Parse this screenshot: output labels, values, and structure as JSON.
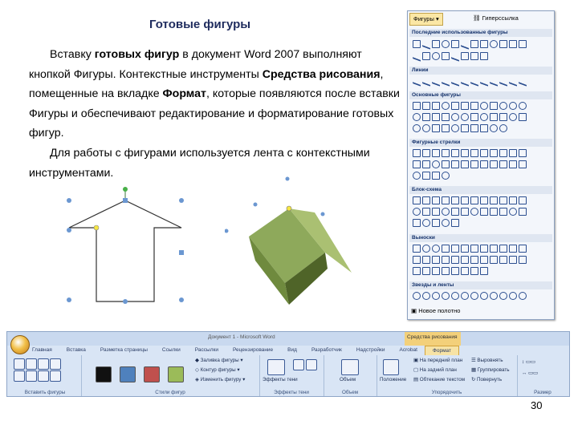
{
  "title": "Готовые фигуры",
  "para1": {
    "p1": "Вставку ",
    "b1": "готовых фигур",
    "p2": " в документ Word 2007 выполняют кнопкой Фигуры. Контекстные инструменты ",
    "b2": "Средства рисования",
    "p3": ", помещенные на вкладке ",
    "b3": "Формат",
    "p4": ", которые появляются после вставки Фигуры и обеспечивают редактирование и форматирование готовых фигур."
  },
  "para2": "Для работы с фигурами используется лента с контекстными инструментами.",
  "page_number": "30",
  "gallery": {
    "button": "Фигуры",
    "button2": "Гиперссылка",
    "sections": [
      "Последние использованные фигуры",
      "Линии",
      "Основные фигуры",
      "Фигурные стрелки",
      "Блок-схема",
      "Выноски",
      "Звезды и ленты"
    ],
    "footer": "Новое полотно"
  },
  "ribbon": {
    "window_title": "Документ 1 - Microsoft Word",
    "context_title": "Средства рисования",
    "tabs": [
      "Главная",
      "Вставка",
      "Разметка страницы",
      "Ссылки",
      "Рассылки",
      "Рецензирование",
      "Вид",
      "Разработчик",
      "Надстройки",
      "Acrobat",
      "Формат"
    ],
    "groups": {
      "insert_shapes": "Вставить фигуры",
      "shape_styles": "Стили фигур",
      "shadow_effects": "Эффекты тени",
      "volume": "Объем",
      "arrange": "Упорядочить",
      "size": "Размер"
    },
    "buttons": {
      "change_shape": "Изменить фигуру",
      "shape_fill": "Заливка фигуры",
      "shape_outline": "Контур фигуры",
      "shadow": "Эффекты тени",
      "volume": "Объем",
      "position": "Положение",
      "front": "На передний план",
      "back": "На задний план",
      "wrap": "Обтекание текстом",
      "align": "Выровнять",
      "group": "Группировать",
      "rotate": "Повернуть"
    },
    "swatch_colors": [
      "#111111",
      "#4f81bd",
      "#c0504d",
      "#9bbb59"
    ]
  }
}
